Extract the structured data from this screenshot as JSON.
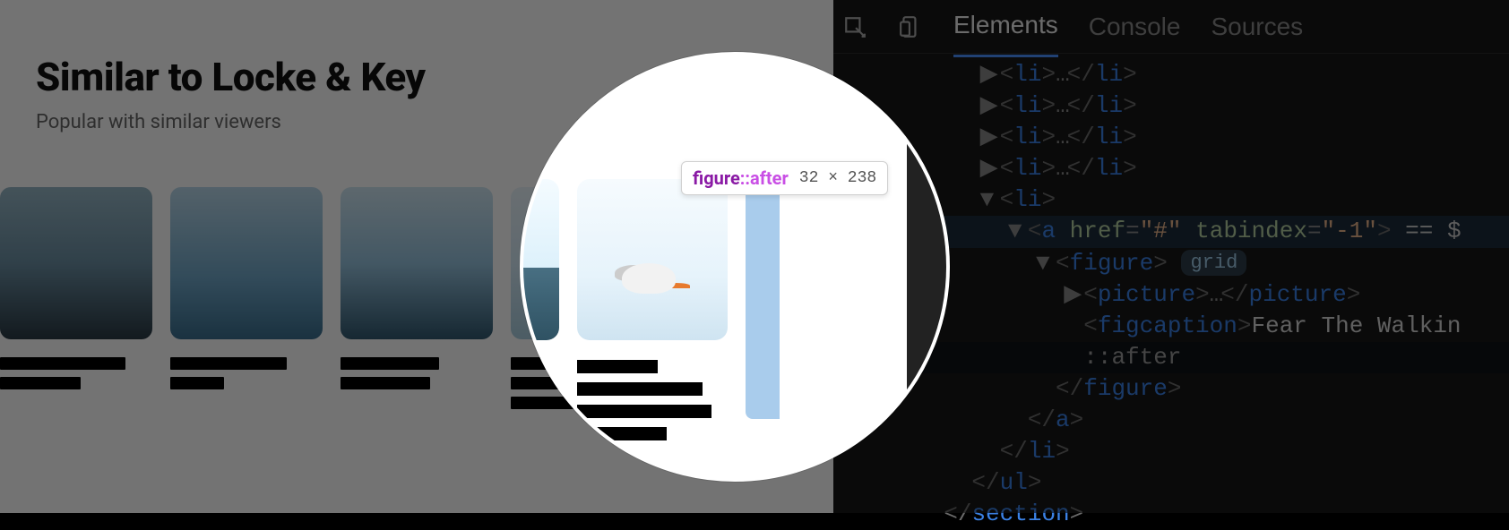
{
  "page": {
    "heading": "Similar to Locke & Key",
    "subheading": "Popular with similar viewers"
  },
  "devtools": {
    "tabs": [
      "Elements",
      "Console",
      "Sources"
    ],
    "active_tab": "Elements",
    "dom_lines": [
      {
        "indent": 3,
        "arrow": "▶",
        "html": "<li>…</li>"
      },
      {
        "indent": 3,
        "arrow": "▶",
        "html": "<li>…</li>"
      },
      {
        "indent": 3,
        "arrow": "▶",
        "html": "<li>…</li>"
      },
      {
        "indent": 3,
        "arrow": "▶",
        "html": "<li>…</li>"
      },
      {
        "indent": 3,
        "arrow": "▼",
        "html": "<li>"
      },
      {
        "indent": 4,
        "arrow": "▼",
        "html": "<a href=\"#\" tabindex=\"-1\">",
        "trail": " == $",
        "selected": true
      },
      {
        "indent": 5,
        "arrow": "▼",
        "html": "<figure>",
        "pill": "grid"
      },
      {
        "indent": 6,
        "arrow": "▶",
        "html": "<picture>…</picture>"
      },
      {
        "indent": 6,
        "arrow": "",
        "html": "<figcaption>",
        "text": "Fear The Walkin"
      },
      {
        "indent": 6,
        "arrow": "",
        "after": "::after",
        "highlight": true
      },
      {
        "indent": 5,
        "arrow": "",
        "html": "</figure>"
      },
      {
        "indent": 4,
        "arrow": "",
        "html": "</a>"
      },
      {
        "indent": 3,
        "arrow": "",
        "html": "</li>"
      },
      {
        "indent": 2,
        "arrow": "",
        "html": "</ul>"
      },
      {
        "indent": 1,
        "arrow": "",
        "html": "</section>"
      }
    ]
  },
  "inspector_tooltip": {
    "element": "figure",
    "pseudo": "::after",
    "dimensions": "32 × 238"
  }
}
